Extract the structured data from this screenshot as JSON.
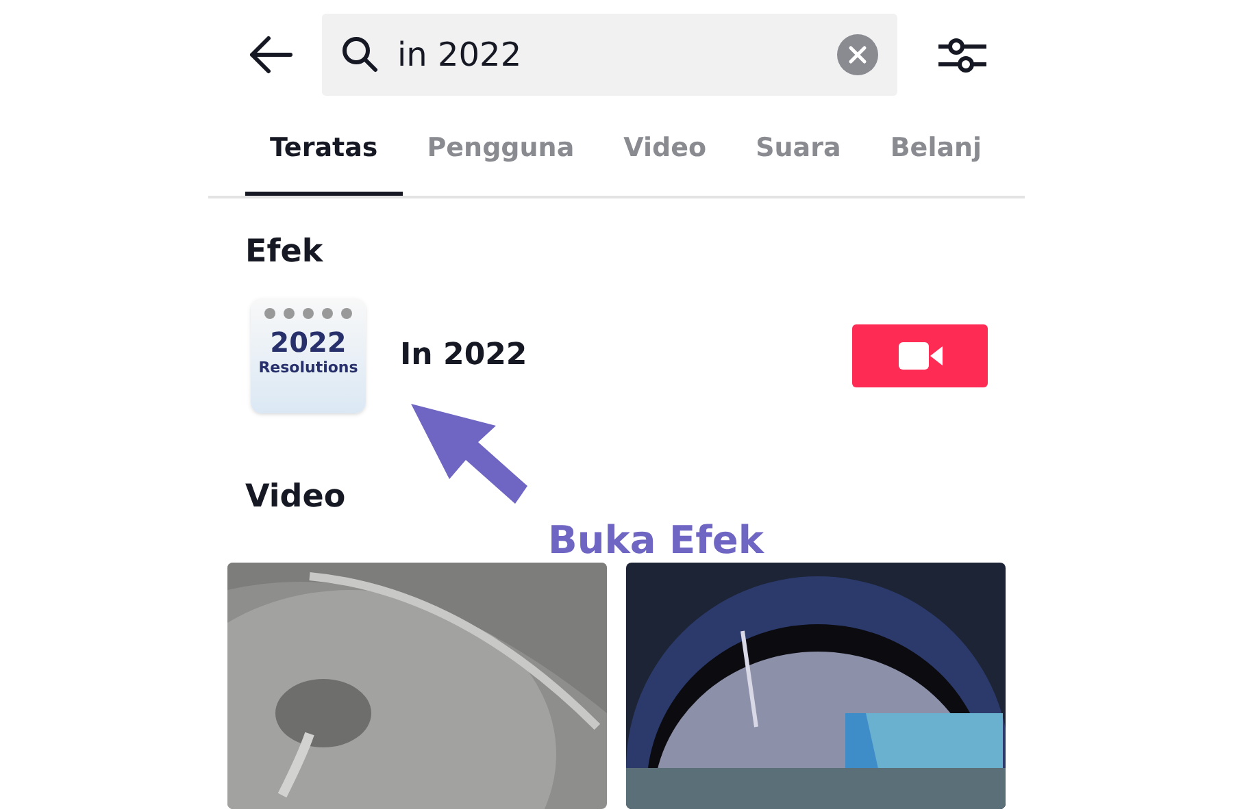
{
  "search": {
    "value": "in 2022"
  },
  "tabs": [
    {
      "label": "Teratas",
      "selected": true
    },
    {
      "label": "Pengguna",
      "selected": false
    },
    {
      "label": "Video",
      "selected": false
    },
    {
      "label": "Suara",
      "selected": false
    },
    {
      "label": "Belanj",
      "selected": false
    }
  ],
  "effects": {
    "heading": "Efek",
    "items": [
      {
        "thumbnail_text": [
          "2022",
          "Resolutions"
        ],
        "name": "In 2022"
      }
    ]
  },
  "videos": {
    "heading": "Video"
  },
  "annotation": {
    "label": "Buka Efek"
  }
}
